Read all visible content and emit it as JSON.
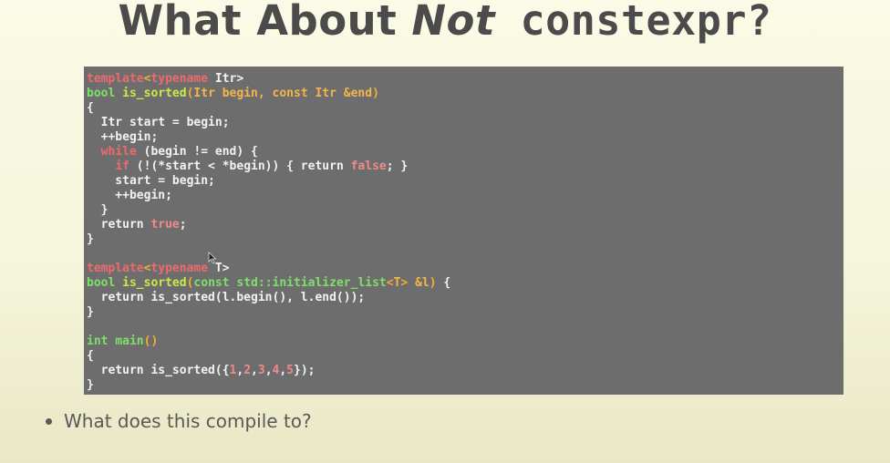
{
  "title": {
    "part1": "What About ",
    "part2": "Not",
    "part3": " constexpr?"
  },
  "code": {
    "lines": [
      [
        [
          "kw",
          "template"
        ],
        [
          "paren",
          "<"
        ],
        [
          "kw",
          "typename"
        ],
        [
          "plain",
          " Itr>"
        ]
      ],
      [
        [
          "type",
          "bool"
        ],
        [
          "plain",
          " "
        ],
        [
          "fn",
          "is_sorted"
        ],
        [
          "paren",
          "("
        ],
        [
          "ns",
          "Itr begin, const Itr &end"
        ],
        [
          "paren",
          ")"
        ]
      ],
      [
        [
          "plain",
          "{"
        ]
      ],
      [
        [
          "plain",
          "  Itr start = begin;"
        ]
      ],
      [
        [
          "plain",
          "  ++begin;"
        ]
      ],
      [
        [
          "plain",
          "  "
        ],
        [
          "kw",
          "while"
        ],
        [
          "plain",
          " (begin != end) {"
        ]
      ],
      [
        [
          "plain",
          "    "
        ],
        [
          "kw",
          "if"
        ],
        [
          "plain",
          " (!(*start < *begin)) { return "
        ],
        [
          "val",
          "false"
        ],
        [
          "plain",
          "; }"
        ]
      ],
      [
        [
          "plain",
          "    start = begin;"
        ]
      ],
      [
        [
          "plain",
          "    ++begin;"
        ]
      ],
      [
        [
          "plain",
          "  }"
        ]
      ],
      [
        [
          "plain",
          "  return "
        ],
        [
          "val",
          "true"
        ],
        [
          "plain",
          ";"
        ]
      ],
      [
        [
          "plain",
          "}"
        ]
      ],
      [
        [
          "plain",
          ""
        ]
      ],
      [
        [
          "kw",
          "template"
        ],
        [
          "paren",
          "<"
        ],
        [
          "kw",
          "typename"
        ],
        [
          "plain",
          " T>"
        ]
      ],
      [
        [
          "type",
          "bool"
        ],
        [
          "plain",
          " "
        ],
        [
          "fn",
          "is_sorted"
        ],
        [
          "paren",
          "("
        ],
        [
          "type",
          "const std::initializer_list"
        ],
        [
          "paren",
          "<"
        ],
        [
          "ns",
          "T"
        ],
        [
          "paren",
          "> "
        ],
        [
          "ns",
          "&l"
        ],
        [
          "paren",
          ")"
        ],
        [
          "plain",
          " {"
        ]
      ],
      [
        [
          "plain",
          "  return is_sorted(l.begin(), l.end());"
        ]
      ],
      [
        [
          "plain",
          "}"
        ]
      ],
      [
        [
          "plain",
          ""
        ]
      ],
      [
        [
          "type",
          "int"
        ],
        [
          "plain",
          " "
        ],
        [
          "type",
          "main"
        ],
        [
          "paren",
          "()"
        ]
      ],
      [
        [
          "plain",
          "{"
        ]
      ],
      [
        [
          "plain",
          "  return is_sorted({"
        ],
        [
          "num",
          "1"
        ],
        [
          "plain",
          ","
        ],
        [
          "num",
          "2"
        ],
        [
          "plain",
          ","
        ],
        [
          "num",
          "3"
        ],
        [
          "plain",
          ","
        ],
        [
          "num",
          "4"
        ],
        [
          "plain",
          ","
        ],
        [
          "num",
          "5"
        ],
        [
          "plain",
          "});"
        ]
      ],
      [
        [
          "plain",
          "}"
        ]
      ]
    ]
  },
  "bullets": [
    "What does this compile to?"
  ],
  "icons": {
    "cursor": "mouse-pointer-icon"
  },
  "colors": {
    "code_background": "#6e6d6e",
    "keyword": "#f06a6a",
    "type": "#7ee06a",
    "function": "#c7e94a"
  }
}
